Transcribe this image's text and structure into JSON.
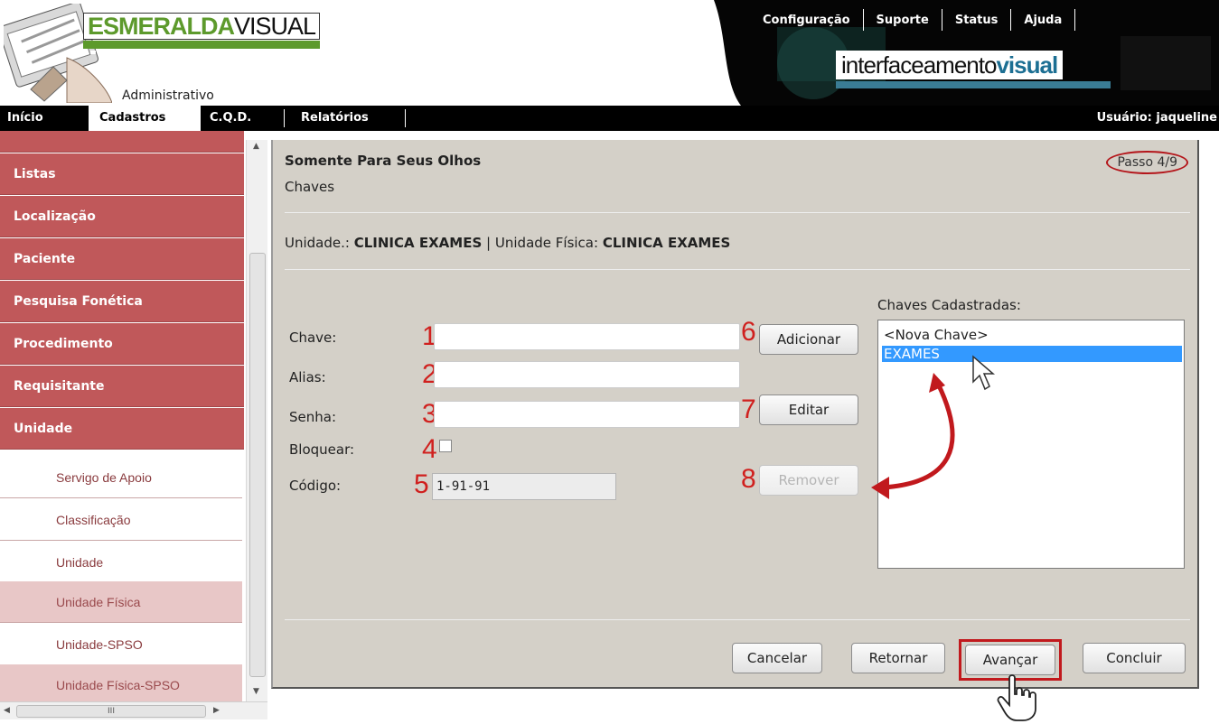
{
  "header": {
    "brand_part1": "ESMERALDA",
    "brand_part2": "VISUAL",
    "subtitle": "Administrativo",
    "partner_part1": "interfaceamento",
    "partner_part2": "visual",
    "top_links": [
      "Configuração",
      "Suporte",
      "Status",
      "Ajuda"
    ]
  },
  "main_nav": {
    "items": [
      "Início",
      "Cadastros",
      "C.Q.D.",
      "Relatórios"
    ],
    "active": "Cadastros",
    "user": "Usuário: jaqueline"
  },
  "sidebar": {
    "main_items": [
      "Listas",
      "Localização",
      "Paciente",
      "Pesquisa Fonética",
      "Procedimento",
      "Requisitante",
      "Unidade"
    ],
    "sub_items": [
      "Servigo de Apoio",
      "Classificação",
      "Unidade",
      "Unidade Física",
      "Unidade-SPSO",
      "Unidade Física-SPSO"
    ],
    "selected_sub": "Unidade Física"
  },
  "panel": {
    "title": "Somente Para Seus Olhos",
    "subtitle": "Chaves",
    "step": "Passo 4/9",
    "unit_label": "Unidade.:",
    "unit_value": "CLINICA EXAMES",
    "sep": "|",
    "physical_label": "Unidade Física:",
    "physical_value": "CLINICA EXAMES"
  },
  "form": {
    "chave_label": "Chave:",
    "alias_label": "Alias:",
    "senha_label": "Senha:",
    "bloquear_label": "Bloquear:",
    "codigo_label": "Código:",
    "codigo_value": "1-91-91",
    "n1": "1",
    "n2": "2",
    "n3": "3",
    "n4": "4",
    "n5": "5",
    "n6": "6",
    "n7": "7",
    "n8": "8"
  },
  "buttons": {
    "adicionar": "Adicionar",
    "editar": "Editar",
    "remover": "Remover",
    "cancelar": "Cancelar",
    "retornar": "Retornar",
    "avancar": "Avançar",
    "concluir": "Concluir"
  },
  "keys_list": {
    "label": "Chaves Cadastradas:",
    "items": [
      "<Nova Chave>",
      "EXAMES"
    ],
    "selected": "EXAMES"
  },
  "scroll": {
    "h_thumb": "III"
  },
  "colors": {
    "sidebar_main": "#c0585a",
    "panel_bg": "#d4d0c8",
    "annotation_red": "#d0201e",
    "selection_blue": "#3399ff"
  }
}
